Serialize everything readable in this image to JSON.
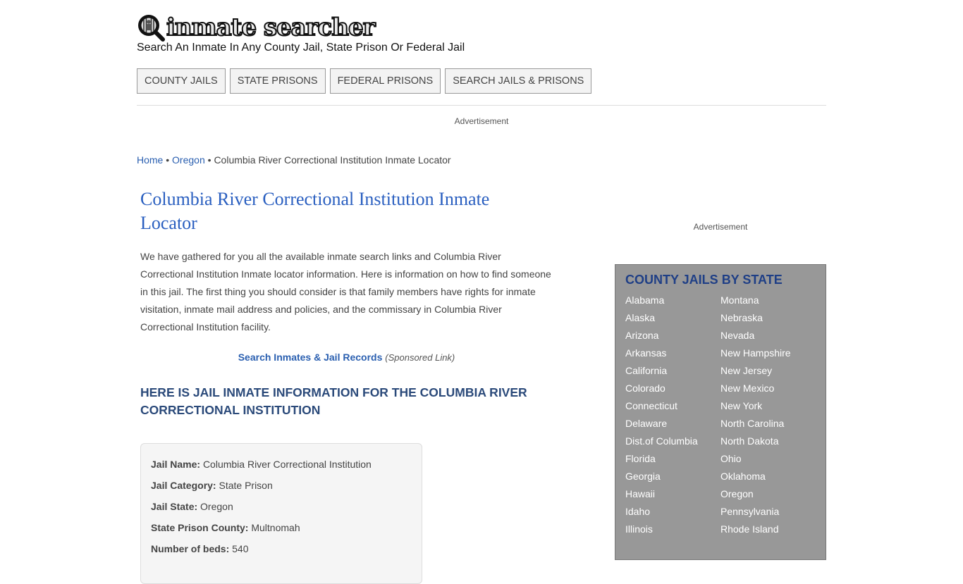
{
  "header": {
    "logo_text": "inmate searcher",
    "tagline": "Search An Inmate In Any County Jail, State Prison Or Federal Jail"
  },
  "nav": {
    "items": [
      {
        "label": "COUNTY JAILS"
      },
      {
        "label": "STATE PRISONS"
      },
      {
        "label": "FEDERAL PRISONS"
      },
      {
        "label": "SEARCH JAILS & PRISONS"
      }
    ]
  },
  "ads": {
    "top_label": "Advertisement",
    "side_label": "Advertisement"
  },
  "breadcrumb": {
    "home": "Home",
    "separator": "•",
    "state": "Oregon",
    "current": "Columbia River Correctional Institution Inmate Locator"
  },
  "main": {
    "title": "Columbia River Correctional Institution Inmate Locator",
    "intro": "We have gathered for you all the available inmate search links and Columbia River Correctional Institution Inmate locator information. Here is information on how to find someone in this jail. The first thing you should consider is that family members have rights for inmate visitation, inmate mail address and policies, and the commissary in Columbia River Correctional Institution facility.",
    "sponsor_link": "Search Inmates & Jail Records",
    "sponsor_note": "(Sponsored Link)",
    "subheading": "HERE IS JAIL INMATE INFORMATION FOR THE COLUMBIA RIVER CORRECTIONAL INSTITUTION",
    "info": [
      {
        "label": "Jail Name:",
        "value": "Columbia River Correctional Institution"
      },
      {
        "label": "Jail Category:",
        "value": "State Prison"
      },
      {
        "label": "Jail State:",
        "value": "Oregon"
      },
      {
        "label": "State Prison County:",
        "value": "Multnomah"
      },
      {
        "label": "Number of beds:",
        "value": "540"
      }
    ]
  },
  "sidebar": {
    "title": "COUNTY JAILS BY STATE",
    "left_states": [
      "Alabama",
      "Alaska",
      "Arizona",
      "Arkansas",
      "California",
      "Colorado",
      "Connecticut",
      "Delaware",
      "Dist.of Columbia",
      "Florida",
      "Georgia",
      "Hawaii",
      "Idaho",
      "Illinois"
    ],
    "right_states": [
      "Montana",
      "Nebraska",
      "Nevada",
      "New Hampshire",
      "New Jersey",
      "New Mexico",
      "New York",
      "North Carolina",
      "North Dakota",
      "Ohio",
      "Oklahoma",
      "Oregon",
      "Pennsylvania",
      "Rhode Island"
    ]
  },
  "colors": {
    "link": "#2a5fb0",
    "title": "#2a5fc0",
    "subhead": "#2b4a7a",
    "sidebar_bg": "#989898",
    "sidebar_title": "#1f3f86"
  }
}
